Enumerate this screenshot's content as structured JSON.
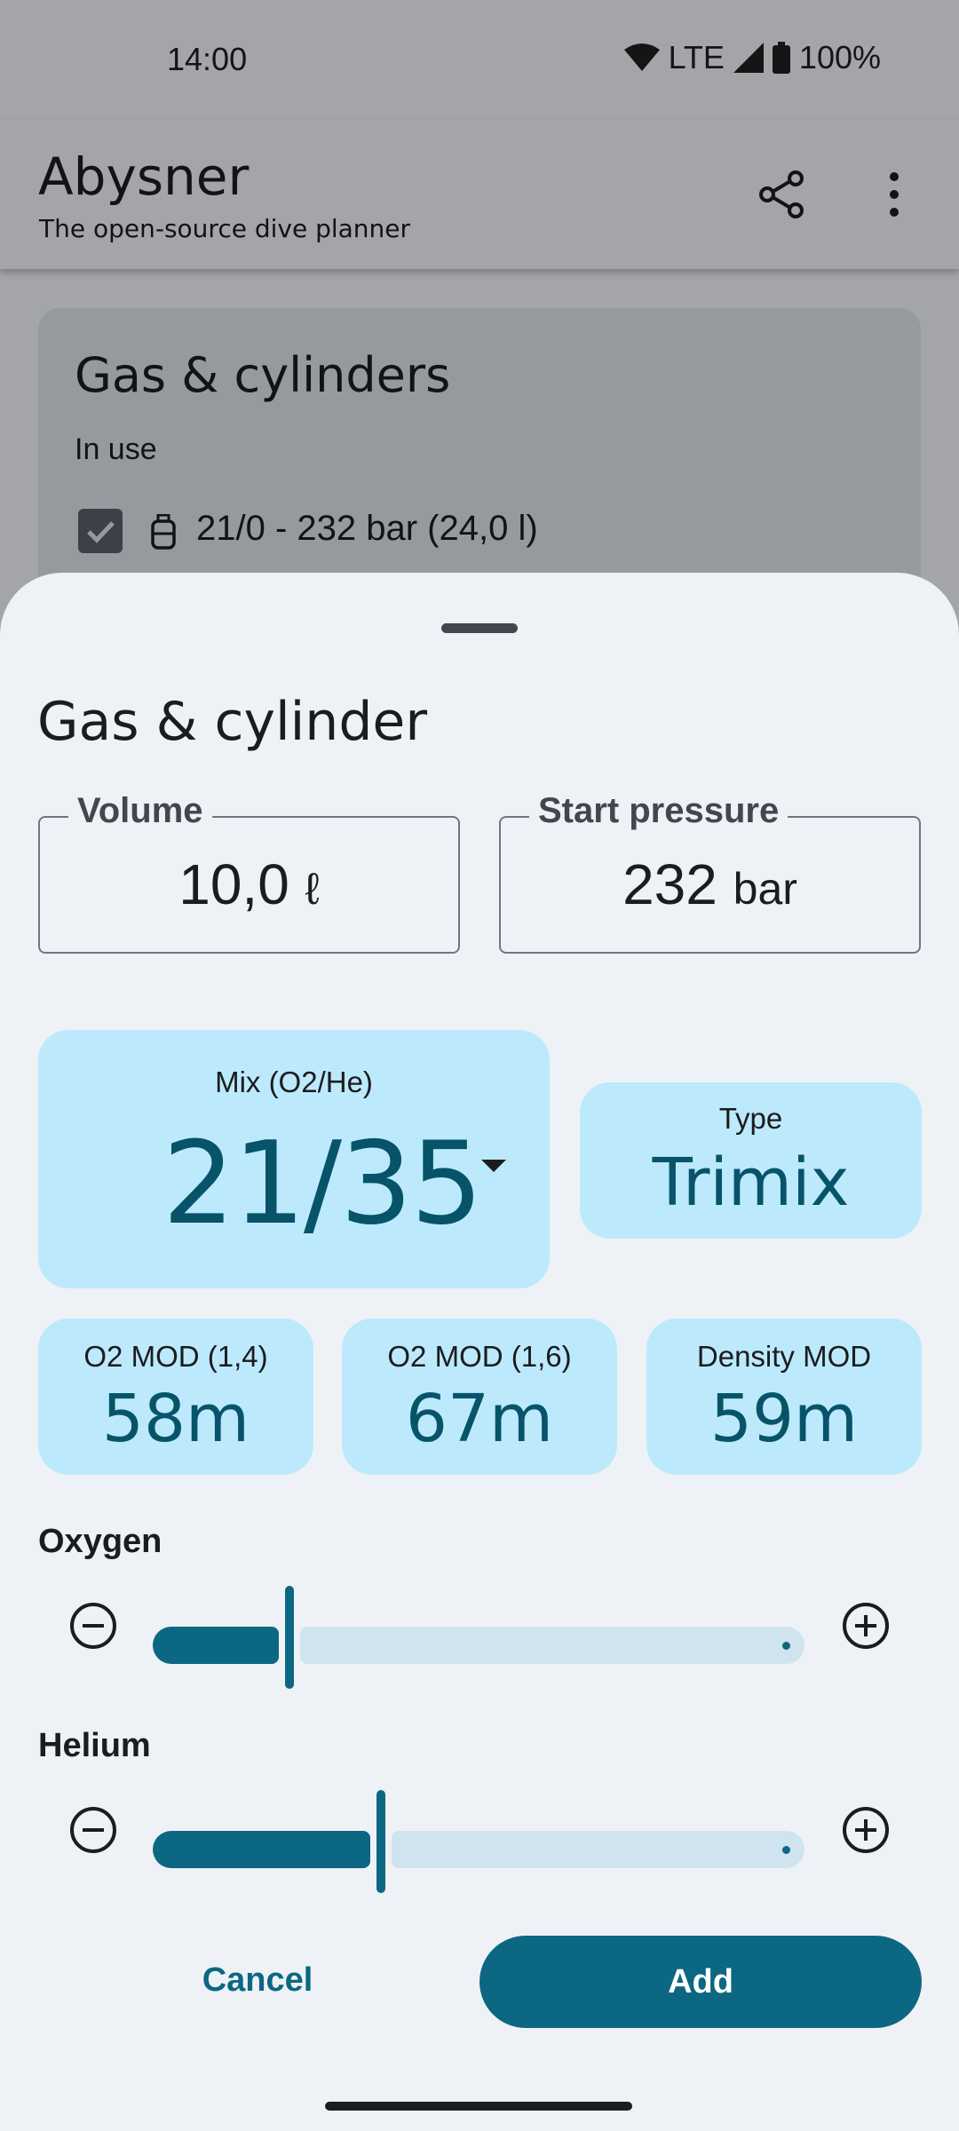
{
  "status_bar": {
    "time": "14:00",
    "network": "LTE",
    "battery": "100%"
  },
  "app_bar": {
    "title": "Abysner",
    "subtitle": "The open-source dive planner",
    "icons": [
      "share-icon",
      "more-vert-icon"
    ]
  },
  "background_card": {
    "title": "Gas & cylinders",
    "subtitle": "In use",
    "cylinder": {
      "label": "21/0 - 232 bar (24,0 l)",
      "checked": true
    }
  },
  "sheet": {
    "title": "Gas & cylinder",
    "volume": {
      "label": "Volume",
      "value": "10,0",
      "unit": "ℓ"
    },
    "start_pressure": {
      "label": "Start pressure",
      "value": "232",
      "unit": "bar"
    },
    "mix": {
      "label": "Mix (O2/He)",
      "value": "21/35"
    },
    "type": {
      "label": "Type",
      "value": "Trimix"
    },
    "mods": [
      {
        "label": "O2 MOD (1,4)",
        "value": "58m"
      },
      {
        "label": "O2 MOD (1,6)",
        "value": "67m"
      },
      {
        "label": "Density MOD",
        "value": "59m"
      }
    ],
    "oxygen": {
      "label": "Oxygen",
      "fraction": 0.21
    },
    "helium": {
      "label": "Helium",
      "fraction": 0.35
    },
    "cancel_label": "Cancel",
    "add_label": "Add"
  },
  "colors": {
    "primary": "#0c6782",
    "tile": "#bde9fc",
    "sheet_bg": "#eef2f6"
  }
}
